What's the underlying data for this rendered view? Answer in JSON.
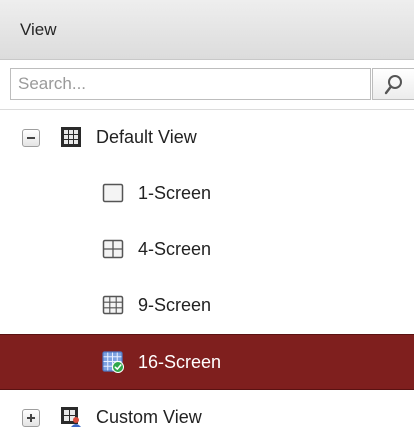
{
  "header": {
    "title": "View"
  },
  "search": {
    "placeholder": "Search..."
  },
  "tree": {
    "default_view": {
      "label": "Default View",
      "toggle_icon": "collapse-minus-icon",
      "icon": "default-view-grid-icon",
      "children": [
        {
          "label": "1-Screen",
          "icon": "one-screen-layout-icon"
        },
        {
          "label": "4-Screen",
          "icon": "four-screen-layout-icon"
        },
        {
          "label": "9-Screen",
          "icon": "nine-screen-layout-icon"
        },
        {
          "label": "16-Screen",
          "icon": "sixteen-screen-layout-icon",
          "selected": true
        }
      ]
    },
    "custom_view": {
      "label": "Custom View",
      "toggle_icon": "expand-plus-icon",
      "icon": "custom-view-icon"
    }
  },
  "colors": {
    "selected_bg": "#7f1f1e",
    "header_bg": "#e2e2e2",
    "check_green": "#2fa84a",
    "layout_blue": "#4e78c4"
  }
}
